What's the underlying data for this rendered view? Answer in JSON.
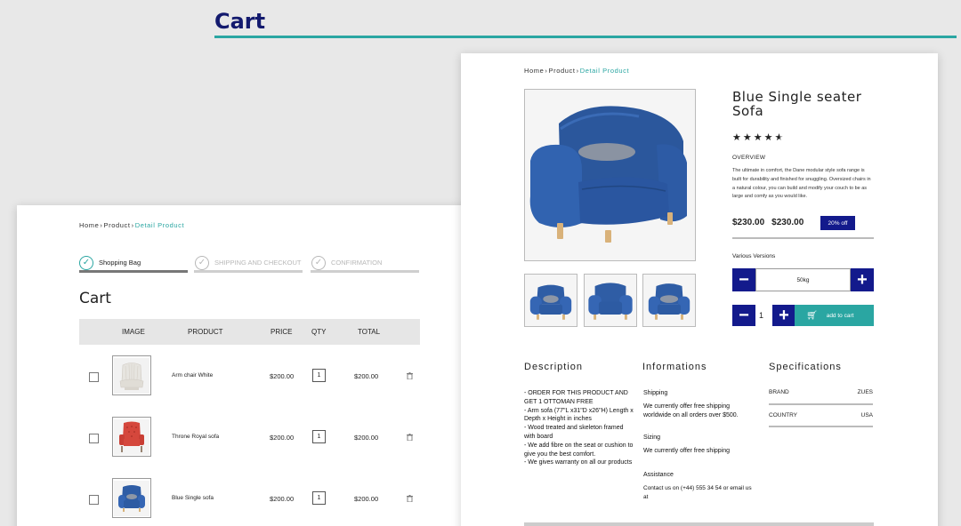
{
  "page": {
    "title": "Cart"
  },
  "colors": {
    "accent": "#2aa6a2",
    "brand": "#131a8c",
    "title": "#131a6e"
  },
  "left": {
    "breadcrumb": {
      "home": "Home",
      "product": "Product",
      "current": "Detail Product"
    },
    "steps": [
      {
        "label": "Shopping Bag",
        "state": "done"
      },
      {
        "label": "SHIPPING AND CHECKOUT",
        "state": "pending"
      },
      {
        "label": "CONFIRMATION",
        "state": "pending"
      }
    ],
    "heading": "Cart",
    "table": {
      "headers": {
        "image": "IMAGE",
        "product": "PRODUCT",
        "price": "PRICE",
        "qty": "QTY",
        "total": "TOTAL"
      },
      "rows": [
        {
          "name": "Arm chair White",
          "price": "$200.00",
          "qty": "1",
          "total": "$200.00",
          "image": "white-armchair",
          "checked": false
        },
        {
          "name": "Throne Royal sofa",
          "price": "$200.00",
          "qty": "1",
          "total": "$200.00",
          "image": "red-throne-chair",
          "checked": false
        },
        {
          "name": "Blue Single sofa",
          "price": "$200.00",
          "qty": "1",
          "total": "$200.00",
          "image": "blue-armchair",
          "checked": false
        }
      ]
    }
  },
  "right": {
    "breadcrumb": {
      "home": "Home",
      "product": "Product",
      "current": "Detail Product"
    },
    "product": {
      "title": "Blue Single seater Sofa",
      "rating": 4.5,
      "overview_label": "OVERVIEW",
      "overview": "The ultimate in comfort, the Dane modular style sofa range is built for durability and finished for snuggling. Oversized chairs in a natural colour, you can build and modify your couch to be as large and comfy as you would like.",
      "price": "$230.00",
      "original_price": "$230.00",
      "discount": "20% off",
      "versions_label": "Various Versions",
      "version_value": "50kg",
      "quantity": "1",
      "add_to_cart": "add to cart"
    },
    "sections": {
      "description": "Description",
      "informations": "Informations",
      "specifications": "Specifications"
    },
    "description_lines": [
      "- ORDER FOR THIS PRODUCT AND GET 1 OTTOMAN FREE",
      "- Arm sofa   (77\"L x31\"D x26\"H) Length x Depth x Height in inches",
      "- Wood treated and skeleton framed with board",
      "- We add fibre on the seat or cushion to give you the best comfort.",
      "- We gives warranty on all our products"
    ],
    "info": {
      "shipping_label": "Shipping",
      "shipping_text": "We currently offer free shipping worldwide on all orders over $500.",
      "sizing_label": "Sizing",
      "sizing_text": "We currently offer free shipping",
      "assistance_label": "Assistance",
      "assistance_text": "Contact us on (+44) 555 34 54 or email us at"
    },
    "specs": [
      {
        "key": "BRAND",
        "value": "ZUES"
      },
      {
        "key": "COUNTRY",
        "value": "USA"
      }
    ]
  }
}
